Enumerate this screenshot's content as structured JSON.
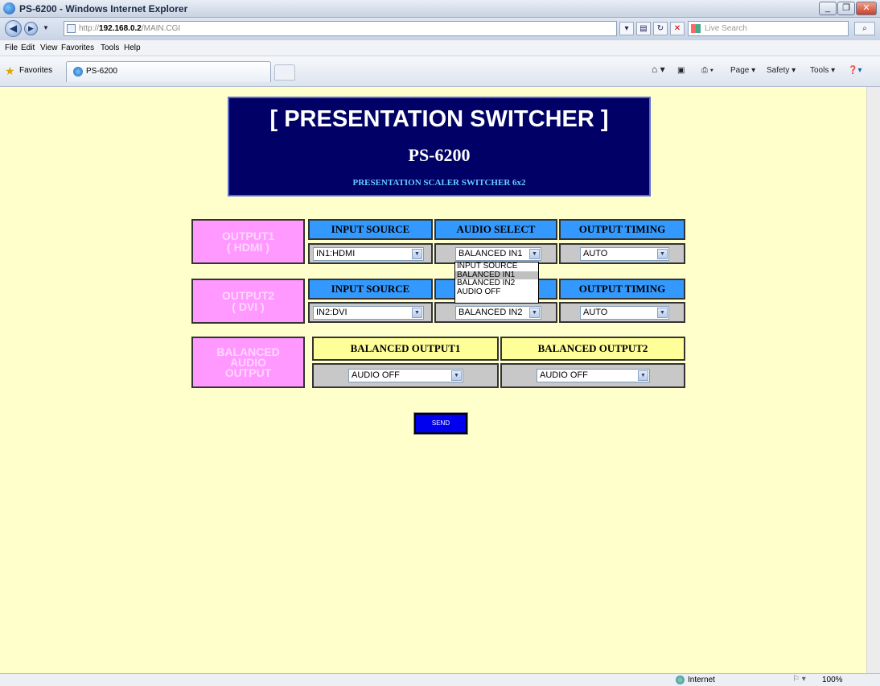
{
  "window": {
    "title": "PS-6200 - Windows Internet Explorer",
    "min": "_",
    "max": "❐",
    "close": "✕"
  },
  "address": {
    "url_prefix": "http://",
    "url_host": "192.168.0.2",
    "url_path": "/MAIN.CGI",
    "search_placeholder": "Live Search"
  },
  "menu": [
    "File",
    "Edit",
    "View",
    "Favorites",
    "Tools",
    "Help"
  ],
  "favorites": {
    "label": "Favorites",
    "tab_title": "PS-6200"
  },
  "commands": {
    "page": "Page ▾",
    "safety": "Safety ▾",
    "tools": "Tools ▾"
  },
  "header": {
    "title": "[ PRESENTATION SWITCHER ]",
    "model": "PS-6200",
    "subtitle": "PRESENTATION SCALER SWITCHER 6x2"
  },
  "output1": {
    "label_line1": "OUTPUT1",
    "label_line2": "( HDMI )",
    "input_header": "INPUT SOURCE",
    "audio_header": "AUDIO SELECT",
    "timing_header": "OUTPUT TIMING",
    "input_value": "IN1:HDMI",
    "audio_value": "BALANCED IN1",
    "timing_value": "AUTO"
  },
  "output2": {
    "label_line1": "OUTPUT2",
    "label_line2": "( DVI )",
    "input_header": "INPUT SOURCE",
    "timing_header": "OUTPUT TIMING",
    "input_value": "IN2:DVI",
    "audio_value": "BALANCED IN2",
    "timing_value": "AUTO"
  },
  "audio_dropdown": {
    "options": [
      "INPUT SOURCE",
      "BALANCED IN1",
      "BALANCED IN2",
      "AUDIO OFF"
    ],
    "highlighted_index": 1
  },
  "balanced": {
    "label_line1": "BALANCED",
    "label_line2": "AUDIO",
    "label_line3": "OUTPUT",
    "out1_header": "BALANCED OUTPUT1",
    "out2_header": "BALANCED OUTPUT2",
    "out1_value": "AUDIO OFF",
    "out2_value": "AUDIO OFF"
  },
  "send_label": "SEND",
  "status": {
    "zone": "Internet",
    "zoom": "100%"
  },
  "colors": {
    "page_bg": "#ffffcc",
    "header_bg": "#000066",
    "output_label_bg": "#ff99ff",
    "blue_header": "#3399ff",
    "yellow_header": "#ffff99",
    "send_bg": "#0000ee"
  }
}
